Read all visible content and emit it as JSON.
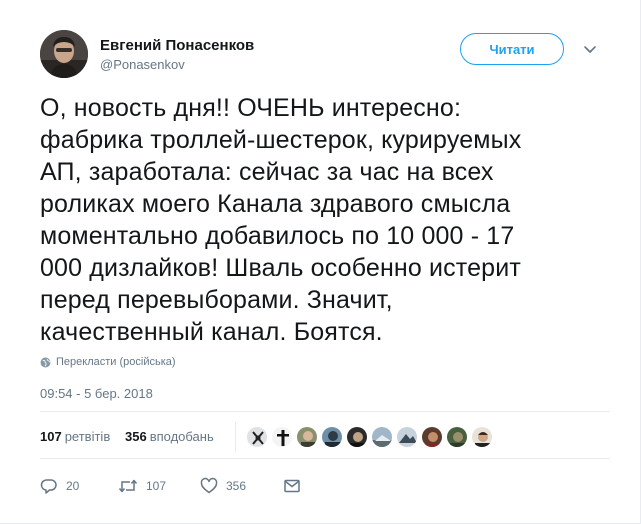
{
  "author": {
    "name": "Евгений Понасенков",
    "handle": "@Ponasenkov"
  },
  "follow_button": {
    "label": "Читати"
  },
  "tweet": {
    "text": "О, новость дня!! ОЧЕНЬ интересно:\nфабрика троллей-шестерок, курируемых\nАП, заработала: сейчас за час на всех\nроликах моего Канала здравого смысла\nмоментально добавилось по 10 000 - 17\n000 дизлайков! Шваль особенно истерит\nперед перевыборами. Значит,\nкачественный канал. Боятся.",
    "translate_label": "Перекласти (російська)",
    "timestamp": "09:54 - 5 бер. 2018"
  },
  "stats": {
    "retweets_count": "107",
    "retweets_label": "ретвітів",
    "likes_count": "356",
    "likes_label": "вподобань"
  },
  "actions": {
    "reply_count": "20",
    "retweet_count": "107",
    "like_count": "356"
  },
  "icons": {
    "reply": "reply-icon",
    "retweet": "retweet-icon",
    "like": "heart-icon",
    "dm": "envelope-icon",
    "translate": "globe-icon",
    "menu": "chevron-down-icon"
  },
  "colors": {
    "accent": "#1da1f2",
    "text": "#14171a",
    "muted": "#657786",
    "divider": "#e6ecf0"
  }
}
